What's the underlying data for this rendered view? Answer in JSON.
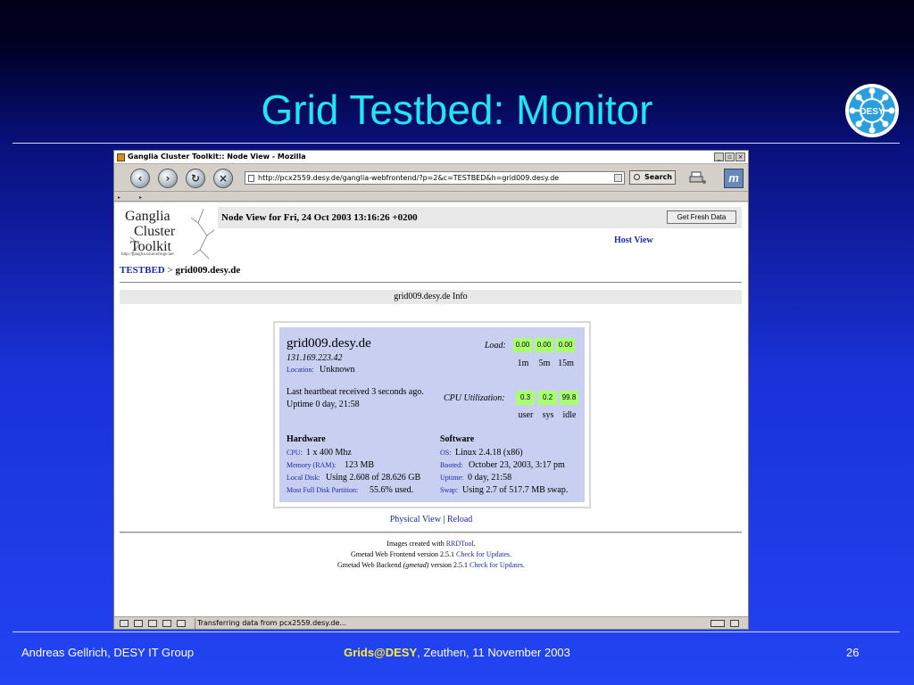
{
  "slide": {
    "title": "Grid Testbed: Monitor",
    "logo_text": "DESY",
    "footer_left": "Andreas Gellrich, DESY IT Group",
    "footer_center_bold": "Grids@DESY",
    "footer_center_rest": ", Zeuthen, 11 November 2003",
    "footer_page": "26"
  },
  "browser": {
    "window_title": "Ganglia Cluster Toolkit:: Node View - Mozilla",
    "url": "http://pcx2559.desy.de/ganglia-webfrontend/?p=2&c=TESTBED&h=grid009.desy.de",
    "search_label": "Search",
    "status_text": "Transferring data from pcx2559.desy.de...",
    "icons": [
      "back-icon",
      "forward-icon",
      "reload-icon",
      "stop-icon",
      "print-icon",
      "mozilla-icon"
    ]
  },
  "page": {
    "logo_lines": [
      "Ganglia",
      "Cluster",
      "Toolkit"
    ],
    "logo_url": "http://ganglia.sourceforge.net",
    "header_text": "Node View for Fri, 24 Oct 2003 13:16:26 +0200",
    "fresh_button": "Get Fresh Data",
    "host_view_link": "Host View",
    "breadcrumb_link": "TESTBED",
    "breadcrumb_sep": ">",
    "breadcrumb_current": "grid009.desy.de",
    "info_title": "grid009.desy.de Info",
    "node": {
      "hostname": "grid009.desy.de",
      "ip": "131.169.223.42",
      "location_label": "Location:",
      "location": "Unknown",
      "heartbeat": "Last heartbeat received 3 seconds ago.",
      "uptime": "Uptime 0 day, 21:58",
      "load_label": "Load:",
      "load": [
        "0.00",
        "0.00",
        "0.00"
      ],
      "load_units": [
        "1m",
        "5m",
        "15m"
      ],
      "cpu_label": "CPU Utilization:",
      "cpu": [
        "0.3",
        "0.2",
        "99.8"
      ],
      "cpu_units": [
        "user",
        "sys",
        "idle"
      ],
      "load_cell_color": "#a8ff70"
    },
    "hardware": {
      "title": "Hardware",
      "rows": [
        {
          "key": "CPU:",
          "value": "1 x 400 Mhz"
        },
        {
          "key": "Memory (RAM):",
          "value": "123 MB"
        },
        {
          "key": "Local Disk:",
          "value": "Using 2.608 of 28.626 GB"
        },
        {
          "key": "Most Full Disk Partition:",
          "value": "55.6% used."
        }
      ]
    },
    "software": {
      "title": "Software",
      "rows": [
        {
          "key": "OS:",
          "value": "Linux 2.4.18 (x86)"
        },
        {
          "key": "Booted:",
          "value": "October 23, 2003, 3:17 pm"
        },
        {
          "key": "Uptime:",
          "value": "0 day, 21:58"
        },
        {
          "key": "Swap:",
          "value": "Using 2.7 of 517.7 MB swap."
        }
      ]
    },
    "physical_view_link": "Physical View",
    "link_separator": "|",
    "reload_link": "Reload",
    "footer": {
      "line1_pre": "Images created with ",
      "line1_link": "RRDTool",
      "line1_post": ".",
      "line2_pre": "Gmetad Web Frontend version 2.5.1 ",
      "line2_link": "Check for Updates.",
      "line3_pre": "Gmetad Web Backend ",
      "line3_italic": "(gmetad)",
      "line3_mid": " version 2.5.1 ",
      "line3_link": "Check for Updates."
    }
  }
}
